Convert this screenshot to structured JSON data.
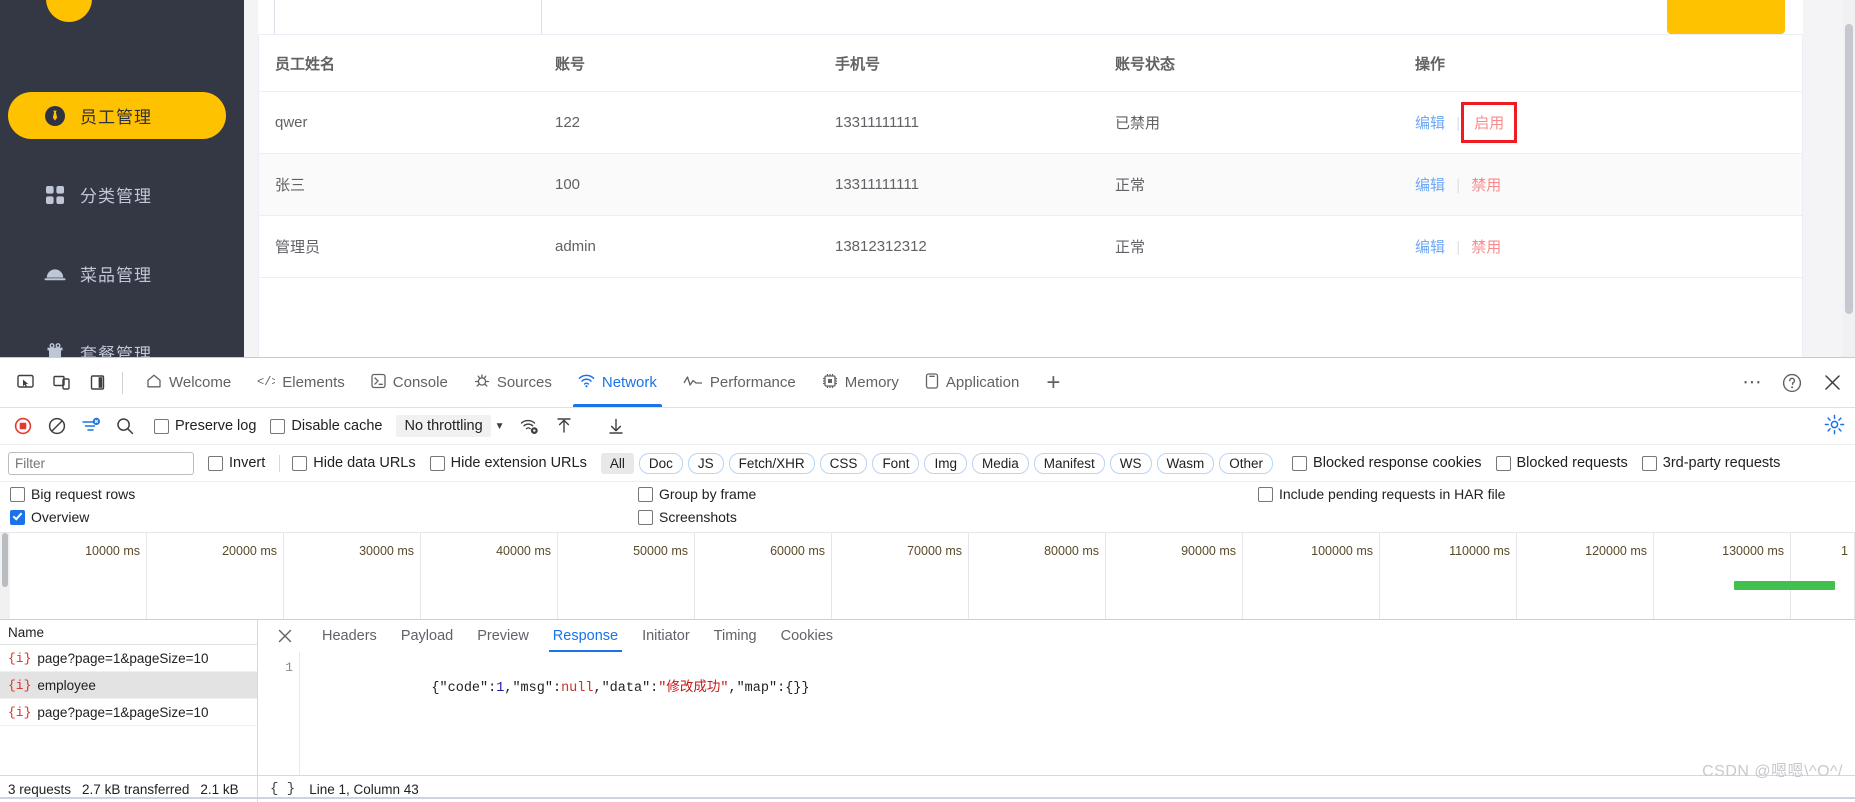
{
  "sidebar": {
    "items": [
      {
        "label": "员工管理",
        "icon": "employee-icon",
        "active": true
      },
      {
        "label": "分类管理",
        "icon": "category-icon",
        "active": false
      },
      {
        "label": "菜品管理",
        "icon": "dish-icon",
        "active": false
      },
      {
        "label": "套餐管理",
        "icon": "combo-icon",
        "active": false
      }
    ]
  },
  "employee_table": {
    "columns": [
      "员工姓名",
      "账号",
      "手机号",
      "账号状态",
      "操作"
    ],
    "rows": [
      {
        "name": "qwer",
        "account": "122",
        "phone": "13311111111",
        "status": "已禁用",
        "edit": "编辑",
        "toggle": "启用",
        "highlighted": true
      },
      {
        "name": "张三",
        "account": "100",
        "phone": "13311111111",
        "status": "正常",
        "edit": "编辑",
        "toggle": "禁用",
        "highlighted": false
      },
      {
        "name": "管理员",
        "account": "admin",
        "phone": "13812312312",
        "status": "正常",
        "edit": "编辑",
        "toggle": "禁用",
        "highlighted": false
      }
    ]
  },
  "devtools": {
    "tabs": [
      {
        "label": "Welcome",
        "icon": "home-icon",
        "selected": false
      },
      {
        "label": "Elements",
        "icon": "code-icon",
        "selected": false
      },
      {
        "label": "Console",
        "icon": "console-icon",
        "selected": false
      },
      {
        "label": "Sources",
        "icon": "sources-icon",
        "selected": false
      },
      {
        "label": "Network",
        "icon": "network-icon",
        "selected": true
      },
      {
        "label": "Performance",
        "icon": "performance-icon",
        "selected": false
      },
      {
        "label": "Memory",
        "icon": "memory-icon",
        "selected": false
      },
      {
        "label": "Application",
        "icon": "application-icon",
        "selected": false
      }
    ],
    "add_tab": "+",
    "toolbar": {
      "record_icon": "record-stop-icon",
      "clear_icon": "clear-icon",
      "filter_icon": "filter-icon",
      "search_icon": "search-icon",
      "preserve_log": "Preserve log",
      "preserve_log_checked": false,
      "disable_cache": "Disable cache",
      "disable_cache_checked": false,
      "throttling": "No throttling",
      "throttling_caret": "▼",
      "wifi_icon": "network-conditions-icon",
      "import_icon": "import-har-icon",
      "export_icon": "export-har-icon",
      "settings_icon": "gear-icon"
    },
    "filterbar": {
      "filter_placeholder": "Filter",
      "filter_value": "",
      "invert": "Invert",
      "invert_checked": false,
      "hide_data_urls": "Hide data URLs",
      "hide_data_urls_checked": false,
      "hide_extension_urls": "Hide extension URLs",
      "hide_extension_urls_checked": false,
      "types": [
        "All",
        "Doc",
        "JS",
        "Fetch/XHR",
        "CSS",
        "Font",
        "Img",
        "Media",
        "Manifest",
        "WS",
        "Wasm",
        "Other"
      ],
      "selected_type": "All",
      "blocked_response_cookies": "Blocked response cookies",
      "blocked_requests": "Blocked requests",
      "third_party_requests": "3rd-party requests"
    },
    "options": {
      "big_request_rows": "Big request rows",
      "big_request_rows_checked": false,
      "overview": "Overview",
      "overview_checked": true,
      "group_by_frame": "Group by frame",
      "group_by_frame_checked": false,
      "screenshots": "Screenshots",
      "screenshots_checked": false,
      "include_pending": "Include pending requests in HAR file",
      "include_pending_checked": false
    },
    "requests": {
      "column_header": "Name",
      "items": [
        {
          "name": "page?page=1&pageSize=10",
          "selected": false
        },
        {
          "name": "employee",
          "selected": true
        },
        {
          "name": "page?page=1&pageSize=10",
          "selected": false
        }
      ],
      "status": [
        "3 requests",
        "2.7 kB transferred",
        "2.1 kB"
      ]
    },
    "detail": {
      "tabs": [
        "Headers",
        "Payload",
        "Preview",
        "Response",
        "Initiator",
        "Timing",
        "Cookies"
      ],
      "selected_tab": "Response",
      "close_icon": "close-icon",
      "line_number": "1",
      "response_body": "{\"code\":1,\"msg\":null,\"data\":\"修改成功\",\"map\":{}}",
      "response_tokens": [
        {
          "text": "{\"code\":",
          "type": "plain"
        },
        {
          "text": "1",
          "type": "number"
        },
        {
          "text": ",\"msg\":",
          "type": "plain"
        },
        {
          "text": "null",
          "type": "null"
        },
        {
          "text": ",\"data\":",
          "type": "plain"
        },
        {
          "text": "\"修改成功\"",
          "type": "string"
        },
        {
          "text": ",\"map\":{}}",
          "type": "plain"
        }
      ],
      "format_icon": "{ }",
      "cursor_position": "Line 1, Column 43"
    }
  },
  "overview": {
    "ticks": [
      "10000 ms",
      "20000 ms",
      "30000 ms",
      "40000 ms",
      "50000 ms",
      "60000 ms",
      "70000 ms",
      "80000 ms",
      "90000 ms",
      "100000 ms",
      "110000 ms",
      "120000 ms",
      "130000 ms",
      "1"
    ],
    "bar_color": "#41c050"
  },
  "watermark": "CSDN @嗯嗯\\^O^/"
}
